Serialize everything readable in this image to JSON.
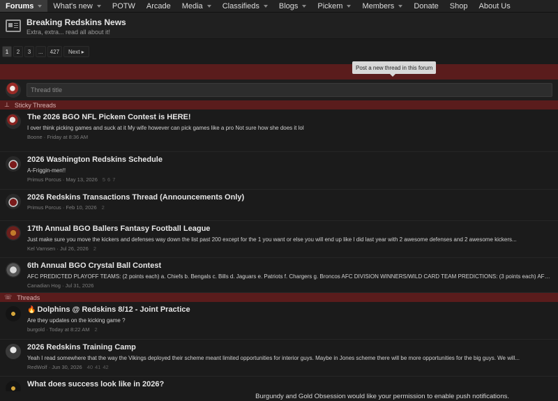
{
  "nav": {
    "items": [
      {
        "label": "Forums",
        "caret": true,
        "active": true
      },
      {
        "label": "What's new",
        "caret": true
      },
      {
        "label": "POTW",
        "caret": false
      },
      {
        "label": "Arcade",
        "caret": false
      },
      {
        "label": "Media",
        "caret": true
      },
      {
        "label": "Classifieds",
        "caret": true
      },
      {
        "label": "Blogs",
        "caret": true
      },
      {
        "label": "Pickem",
        "caret": true
      },
      {
        "label": "Members",
        "caret": true
      },
      {
        "label": "Donate",
        "caret": false
      },
      {
        "label": "Shop",
        "caret": false
      },
      {
        "label": "About Us",
        "caret": false
      }
    ]
  },
  "forum": {
    "title": "Breaking Redskins News",
    "description": "Extra, extra... read all about it!",
    "icon": "newspaper-icon"
  },
  "pager": {
    "pages": [
      "1",
      "2",
      "3",
      "...",
      "427"
    ],
    "current": "1",
    "next_label": "Next ▸"
  },
  "tooltip": "Post a new thread in this forum",
  "quick_thread": {
    "placeholder": "Thread title"
  },
  "sticky": {
    "label": "Sticky Threads",
    "icon": "pin-icon",
    "threads": [
      {
        "title": "The 2026 BGO NFL Pickem Contest is HERE!",
        "snippet": "I over think picking games and suck at it My wife however can pick games like a pro Not sure how she does it lol",
        "meta": "Boone · Friday at 8:36 AM",
        "pages": [],
        "avatar": "av-b"
      },
      {
        "title": "2026 Washington Redskins Schedule",
        "snippet": "A-Friggin-men!!",
        "meta": "Primus Porcus · May 13, 2026",
        "pages": [
          "5",
          "6",
          "7"
        ],
        "avatar": "av-primus"
      },
      {
        "title": "2026 Redskins Transactions Thread (Announcements Only)",
        "snippet": "",
        "meta": "Primus Porcus · Feb 10, 2026",
        "pages": [
          "2"
        ],
        "avatar": "av-primus"
      },
      {
        "title": "17th Annual BGO Ballers Fantasy Football League",
        "snippet": "Just make sure you move the kickers and defenses way down the list past 200 except for the 1 you want or else you will end up like I did last year with 2 awesome defenses and 2 awesome kickers...",
        "meta": "Kel Varnsen · Jul 26, 2026",
        "pages": [
          "2"
        ],
        "avatar": "av-kel"
      },
      {
        "title": "6th Annual BGO Crystal Ball Contest",
        "snippet": "AFC PREDICTED PLAYOFF TEAMS: (2 points each) a. Chiefs b. Bengals c. Bills d. Jaguars e. Patriots f. Chargers g. Broncos AFC DIVISION WINNERS/WILD CARD TEAM PREDICTIONS: (3 points each) AFC...",
        "meta": "Canadian Hog · Jul 31, 2026",
        "pages": [],
        "avatar": "av-hog"
      }
    ]
  },
  "threads": {
    "label": "Threads",
    "icon": "chat-icon",
    "items": [
      {
        "title": "Dolphins @ Redskins 8/12 - Joint Practice",
        "hot": true,
        "snippet": "Are they updates on the kicking game ?",
        "meta": "burgold · Today at 8:22 AM",
        "pages": [
          "2"
        ],
        "avatar": "av-burg"
      },
      {
        "title": "2026 Redskins Training Camp",
        "hot": false,
        "snippet": "Yeah I read somewhere that the way the Vikings deployed their scheme meant limited opportunities for interior guys. Maybe in Jones scheme there will be more opportunities for the big guys. We will...",
        "meta": "RedWolf · Jun 30, 2026",
        "pages": [
          "40",
          "41",
          "42"
        ],
        "avatar": "av-red"
      },
      {
        "title": "What does success look like in 2026?",
        "hot": false,
        "snippet": "",
        "meta": "",
        "pages": [],
        "avatar": "av-burg"
      }
    ]
  },
  "push_notice": "Burgundy and Gold Obsession would like your permission to enable push notifications."
}
